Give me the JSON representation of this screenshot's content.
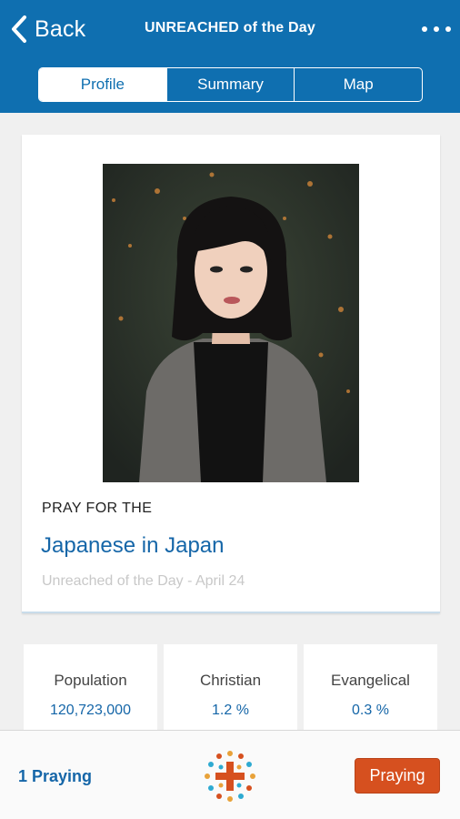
{
  "header": {
    "back_label": "Back",
    "title": "UNREACHED of the Day",
    "more_icon": "more-dots-icon"
  },
  "tabs": [
    {
      "label": "Profile",
      "active": true
    },
    {
      "label": "Summary",
      "active": false
    },
    {
      "label": "Map",
      "active": false
    }
  ],
  "profile": {
    "photo_description_icon": "portrait-photo",
    "pray_for": "PRAY FOR THE",
    "people_name": "Japanese in Japan",
    "day_label": "Unreached of the Day - April 24"
  },
  "stats": [
    {
      "label": "Population",
      "value": "120,723,000"
    },
    {
      "label": "Christian",
      "value": "1.2 %"
    },
    {
      "label": "Evangelical",
      "value": "0.3 %"
    }
  ],
  "bottom": {
    "praying_count": "1 Praying",
    "logo_icon": "cross-dots-logo",
    "praying_button": "Praying"
  },
  "colors": {
    "header": "#0f6fb0",
    "accent_text": "#1566a8",
    "button": "#d6501f"
  }
}
